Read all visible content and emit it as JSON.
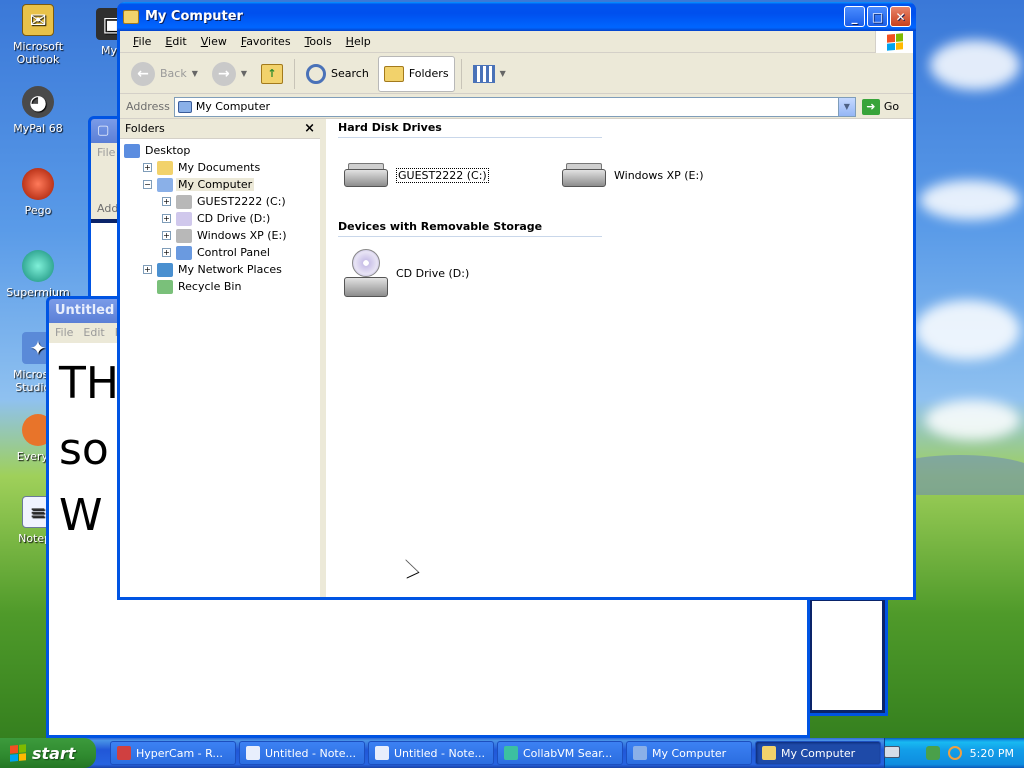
{
  "desktop": {
    "icons": [
      {
        "label": "Microsoft Outlook",
        "icon": "outlook-icon"
      },
      {
        "label": "MyPal 68",
        "icon": "mypal-icon"
      },
      {
        "label": "Pego",
        "icon": "pego-icon"
      },
      {
        "label": "Supermium",
        "icon": "supermium-icon"
      },
      {
        "label": "Microsoft Studio 2",
        "icon": "studio-icon"
      },
      {
        "label": "Everyth",
        "icon": "everything-icon"
      },
      {
        "label": "Notepa",
        "icon": "notepad-icon"
      },
      {
        "label": "My",
        "icon": "shortcut-icon"
      }
    ]
  },
  "background_windows": {
    "notepad_title": "Untitled",
    "notepad_menu": [
      "File",
      "Edit",
      "F"
    ],
    "notepad_text_lines": [
      "TH",
      "so",
      "W"
    ],
    "explorer_menu_fragment": "File",
    "explorer_address_fragment": "Addr"
  },
  "window": {
    "title": "My Computer",
    "menu": [
      "File",
      "Edit",
      "View",
      "Favorites",
      "Tools",
      "Help"
    ],
    "toolbar": {
      "back": "Back",
      "search": "Search",
      "folders": "Folders"
    },
    "address": {
      "label": "Address",
      "value": "My Computer",
      "go": "Go"
    },
    "folders_pane": {
      "title": "Folders",
      "close": "×",
      "tree": [
        {
          "label": "Desktop",
          "level": 0,
          "expander": "",
          "icon": "desktop-icon"
        },
        {
          "label": "My Documents",
          "level": 1,
          "expander": "+",
          "icon": "my-documents-icon"
        },
        {
          "label": "My Computer",
          "level": 1,
          "expander": "−",
          "icon": "my-computer-icon",
          "selected": true
        },
        {
          "label": "GUEST2222 (C:)",
          "level": 2,
          "expander": "+",
          "icon": "hard-drive-icon"
        },
        {
          "label": "CD Drive (D:)",
          "level": 2,
          "expander": "+",
          "icon": "cd-drive-icon"
        },
        {
          "label": "Windows XP (E:)",
          "level": 2,
          "expander": "+",
          "icon": "hard-drive-icon"
        },
        {
          "label": "Control Panel",
          "level": 2,
          "expander": "+",
          "icon": "control-panel-icon"
        },
        {
          "label": "My Network Places",
          "level": 1,
          "expander": "+",
          "icon": "network-places-icon"
        },
        {
          "label": "Recycle Bin",
          "level": 1,
          "expander": "",
          "icon": "recycle-bin-icon"
        }
      ]
    },
    "content": {
      "groups": [
        {
          "title": "Hard Disk Drives",
          "items": [
            "GUEST2222 (C:)",
            "Windows XP (E:)"
          ]
        },
        {
          "title": "Devices with Removable Storage",
          "items": [
            "CD Drive (D:)"
          ]
        }
      ]
    }
  },
  "taskbar": {
    "start": "start",
    "buttons": [
      {
        "label": "HyperCam - R...",
        "icon": "hypercam-icon",
        "active": false
      },
      {
        "label": "Untitled - Note...",
        "icon": "notepad-icon",
        "active": false
      },
      {
        "label": "Untitled - Note...",
        "icon": "notepad-icon",
        "active": false
      },
      {
        "label": "CollabVM Sear...",
        "icon": "collabvm-icon",
        "active": false
      },
      {
        "label": "My Computer",
        "icon": "my-computer-icon",
        "active": false
      },
      {
        "label": "My Computer",
        "icon": "folder-icon",
        "active": true
      }
    ],
    "clock": "5:20 PM"
  },
  "colors": {
    "xp_blue": "#0054e3",
    "window_face": "#ece9d8",
    "taskbar_blue": "#245edb",
    "start_green": "#3c9a3c"
  }
}
